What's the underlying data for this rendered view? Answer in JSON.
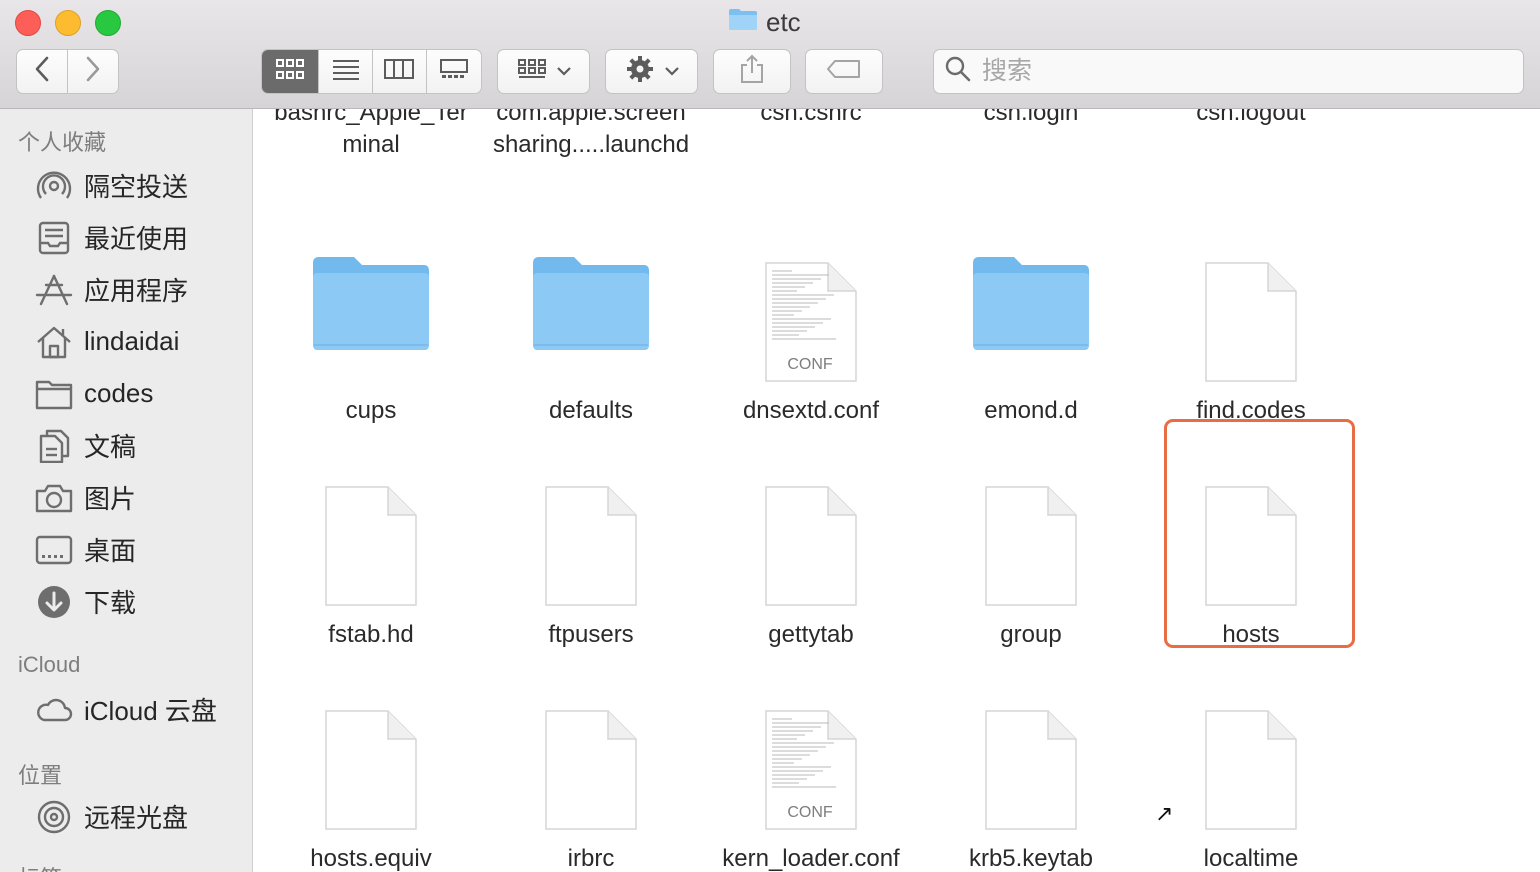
{
  "window": {
    "title": "etc",
    "folder_icon": "folder-icon"
  },
  "toolbar": {
    "back_icon": "chevron-left-icon",
    "forward_icon": "chevron-right-icon",
    "view_modes": [
      "icon-view-icon",
      "list-view-icon",
      "column-view-icon",
      "gallery-view-icon"
    ],
    "selected_view": "icon-view-icon",
    "group_icon": "group-by-icon",
    "action_icon": "gear-icon",
    "share_icon": "share-icon",
    "tag_icon": "tag-icon",
    "search_placeholder": "搜索",
    "search_icon": "search-icon"
  },
  "sidebar": {
    "favorites_title": "个人收藏",
    "favorites": [
      {
        "label": "隔空投送",
        "icon": "airdrop-icon"
      },
      {
        "label": "最近使用",
        "icon": "recents-icon"
      },
      {
        "label": "应用程序",
        "icon": "applications-icon"
      },
      {
        "label": "lindaidai",
        "icon": "home-icon"
      },
      {
        "label": "codes",
        "icon": "folder-icon"
      },
      {
        "label": "文稿",
        "icon": "documents-icon"
      },
      {
        "label": "图片",
        "icon": "camera-icon"
      },
      {
        "label": "桌面",
        "icon": "desktop-icon"
      },
      {
        "label": "下载",
        "icon": "download-icon"
      }
    ],
    "icloud_title": "iCloud",
    "icloud": [
      {
        "label": "iCloud 云盘",
        "icon": "cloud-icon"
      }
    ],
    "locations_title": "位置",
    "locations": [
      {
        "label": "远程光盘",
        "icon": "disc-icon"
      }
    ],
    "tags_title": "标签"
  },
  "files": [
    {
      "name": "bashrc_Apple_Ter\nminal",
      "kind": "document"
    },
    {
      "name": "com.apple.screen\nsharing.....launchd",
      "kind": "document"
    },
    {
      "name": "csh.cshrc",
      "kind": "document"
    },
    {
      "name": "csh.login",
      "kind": "document"
    },
    {
      "name": "csh.logout",
      "kind": "document"
    },
    {
      "name": "cups",
      "kind": "folder"
    },
    {
      "name": "defaults",
      "kind": "folder"
    },
    {
      "name": "dnsextd.conf",
      "kind": "conf",
      "badge": "CONF"
    },
    {
      "name": "emond.d",
      "kind": "folder"
    },
    {
      "name": "find.codes",
      "kind": "document"
    },
    {
      "name": "fstab.hd",
      "kind": "document"
    },
    {
      "name": "ftpusers",
      "kind": "document"
    },
    {
      "name": "gettytab",
      "kind": "document"
    },
    {
      "name": "group",
      "kind": "document"
    },
    {
      "name": "hosts",
      "kind": "document",
      "highlighted": true
    },
    {
      "name": "hosts.equiv",
      "kind": "document"
    },
    {
      "name": "irbrc",
      "kind": "document"
    },
    {
      "name": "kern_loader.conf",
      "kind": "conf",
      "badge": "CONF"
    },
    {
      "name": "krb5.keytab",
      "kind": "document"
    },
    {
      "name": "localtime",
      "kind": "alias"
    }
  ],
  "colors": {
    "highlight": "#e86c44",
    "folder": "#8ccaf5"
  }
}
